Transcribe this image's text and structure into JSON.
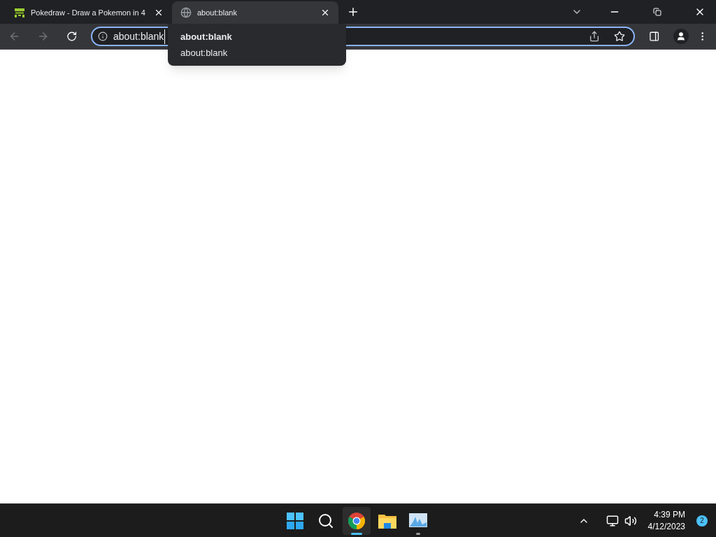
{
  "tabs": [
    {
      "title": "Pokedraw - Draw a Pokemon in 4",
      "kind": "frog",
      "selected": false
    },
    {
      "title": "about:blank",
      "kind": "globe",
      "selected": true
    }
  ],
  "address_bar": {
    "value": "about:blank"
  },
  "suggestions": [
    {
      "text": "about:blank",
      "bold": true
    },
    {
      "text": "about:blank",
      "bold": false
    }
  ],
  "taskbar": {
    "apps": [
      {
        "kind": "start",
        "active": false,
        "running": false
      },
      {
        "kind": "search",
        "active": false,
        "running": false
      },
      {
        "kind": "chrome",
        "active": true,
        "running": true
      },
      {
        "kind": "folder",
        "active": false,
        "running": false
      },
      {
        "kind": "monitor",
        "active": false,
        "running": true
      }
    ],
    "time": "4:39 PM",
    "date": "4/12/2023",
    "notifications": "2"
  }
}
